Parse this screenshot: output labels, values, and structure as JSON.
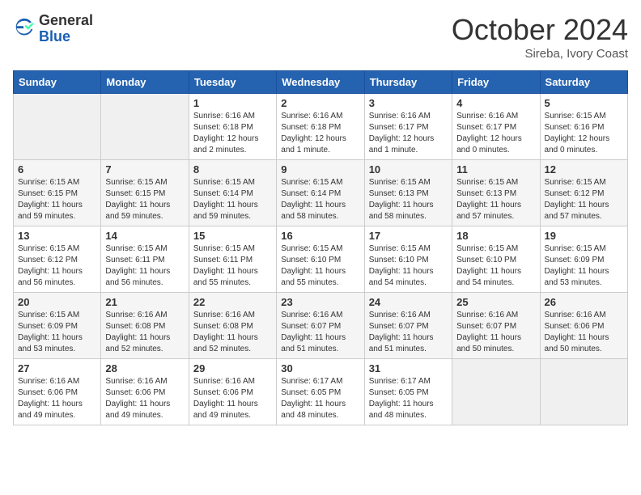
{
  "logo": {
    "general": "General",
    "blue": "Blue"
  },
  "header": {
    "month": "October 2024",
    "location": "Sireba, Ivory Coast"
  },
  "weekdays": [
    "Sunday",
    "Monday",
    "Tuesday",
    "Wednesday",
    "Thursday",
    "Friday",
    "Saturday"
  ],
  "weeks": [
    [
      null,
      null,
      {
        "day": 1,
        "sunrise": "6:16 AM",
        "sunset": "6:18 PM",
        "daylight": "12 hours and 2 minutes."
      },
      {
        "day": 2,
        "sunrise": "6:16 AM",
        "sunset": "6:18 PM",
        "daylight": "12 hours and 1 minute."
      },
      {
        "day": 3,
        "sunrise": "6:16 AM",
        "sunset": "6:17 PM",
        "daylight": "12 hours and 1 minute."
      },
      {
        "day": 4,
        "sunrise": "6:16 AM",
        "sunset": "6:17 PM",
        "daylight": "12 hours and 0 minutes."
      },
      {
        "day": 5,
        "sunrise": "6:15 AM",
        "sunset": "6:16 PM",
        "daylight": "12 hours and 0 minutes."
      }
    ],
    [
      {
        "day": 6,
        "sunrise": "6:15 AM",
        "sunset": "6:15 PM",
        "daylight": "11 hours and 59 minutes."
      },
      {
        "day": 7,
        "sunrise": "6:15 AM",
        "sunset": "6:15 PM",
        "daylight": "11 hours and 59 minutes."
      },
      {
        "day": 8,
        "sunrise": "6:15 AM",
        "sunset": "6:14 PM",
        "daylight": "11 hours and 59 minutes."
      },
      {
        "day": 9,
        "sunrise": "6:15 AM",
        "sunset": "6:14 PM",
        "daylight": "11 hours and 58 minutes."
      },
      {
        "day": 10,
        "sunrise": "6:15 AM",
        "sunset": "6:13 PM",
        "daylight": "11 hours and 58 minutes."
      },
      {
        "day": 11,
        "sunrise": "6:15 AM",
        "sunset": "6:13 PM",
        "daylight": "11 hours and 57 minutes."
      },
      {
        "day": 12,
        "sunrise": "6:15 AM",
        "sunset": "6:12 PM",
        "daylight": "11 hours and 57 minutes."
      }
    ],
    [
      {
        "day": 13,
        "sunrise": "6:15 AM",
        "sunset": "6:12 PM",
        "daylight": "11 hours and 56 minutes."
      },
      {
        "day": 14,
        "sunrise": "6:15 AM",
        "sunset": "6:11 PM",
        "daylight": "11 hours and 56 minutes."
      },
      {
        "day": 15,
        "sunrise": "6:15 AM",
        "sunset": "6:11 PM",
        "daylight": "11 hours and 55 minutes."
      },
      {
        "day": 16,
        "sunrise": "6:15 AM",
        "sunset": "6:10 PM",
        "daylight": "11 hours and 55 minutes."
      },
      {
        "day": 17,
        "sunrise": "6:15 AM",
        "sunset": "6:10 PM",
        "daylight": "11 hours and 54 minutes."
      },
      {
        "day": 18,
        "sunrise": "6:15 AM",
        "sunset": "6:10 PM",
        "daylight": "11 hours and 54 minutes."
      },
      {
        "day": 19,
        "sunrise": "6:15 AM",
        "sunset": "6:09 PM",
        "daylight": "11 hours and 53 minutes."
      }
    ],
    [
      {
        "day": 20,
        "sunrise": "6:15 AM",
        "sunset": "6:09 PM",
        "daylight": "11 hours and 53 minutes."
      },
      {
        "day": 21,
        "sunrise": "6:16 AM",
        "sunset": "6:08 PM",
        "daylight": "11 hours and 52 minutes."
      },
      {
        "day": 22,
        "sunrise": "6:16 AM",
        "sunset": "6:08 PM",
        "daylight": "11 hours and 52 minutes."
      },
      {
        "day": 23,
        "sunrise": "6:16 AM",
        "sunset": "6:07 PM",
        "daylight": "11 hours and 51 minutes."
      },
      {
        "day": 24,
        "sunrise": "6:16 AM",
        "sunset": "6:07 PM",
        "daylight": "11 hours and 51 minutes."
      },
      {
        "day": 25,
        "sunrise": "6:16 AM",
        "sunset": "6:07 PM",
        "daylight": "11 hours and 50 minutes."
      },
      {
        "day": 26,
        "sunrise": "6:16 AM",
        "sunset": "6:06 PM",
        "daylight": "11 hours and 50 minutes."
      }
    ],
    [
      {
        "day": 27,
        "sunrise": "6:16 AM",
        "sunset": "6:06 PM",
        "daylight": "11 hours and 49 minutes."
      },
      {
        "day": 28,
        "sunrise": "6:16 AM",
        "sunset": "6:06 PM",
        "daylight": "11 hours and 49 minutes."
      },
      {
        "day": 29,
        "sunrise": "6:16 AM",
        "sunset": "6:06 PM",
        "daylight": "11 hours and 49 minutes."
      },
      {
        "day": 30,
        "sunrise": "6:17 AM",
        "sunset": "6:05 PM",
        "daylight": "11 hours and 48 minutes."
      },
      {
        "day": 31,
        "sunrise": "6:17 AM",
        "sunset": "6:05 PM",
        "daylight": "11 hours and 48 minutes."
      },
      null,
      null
    ]
  ]
}
